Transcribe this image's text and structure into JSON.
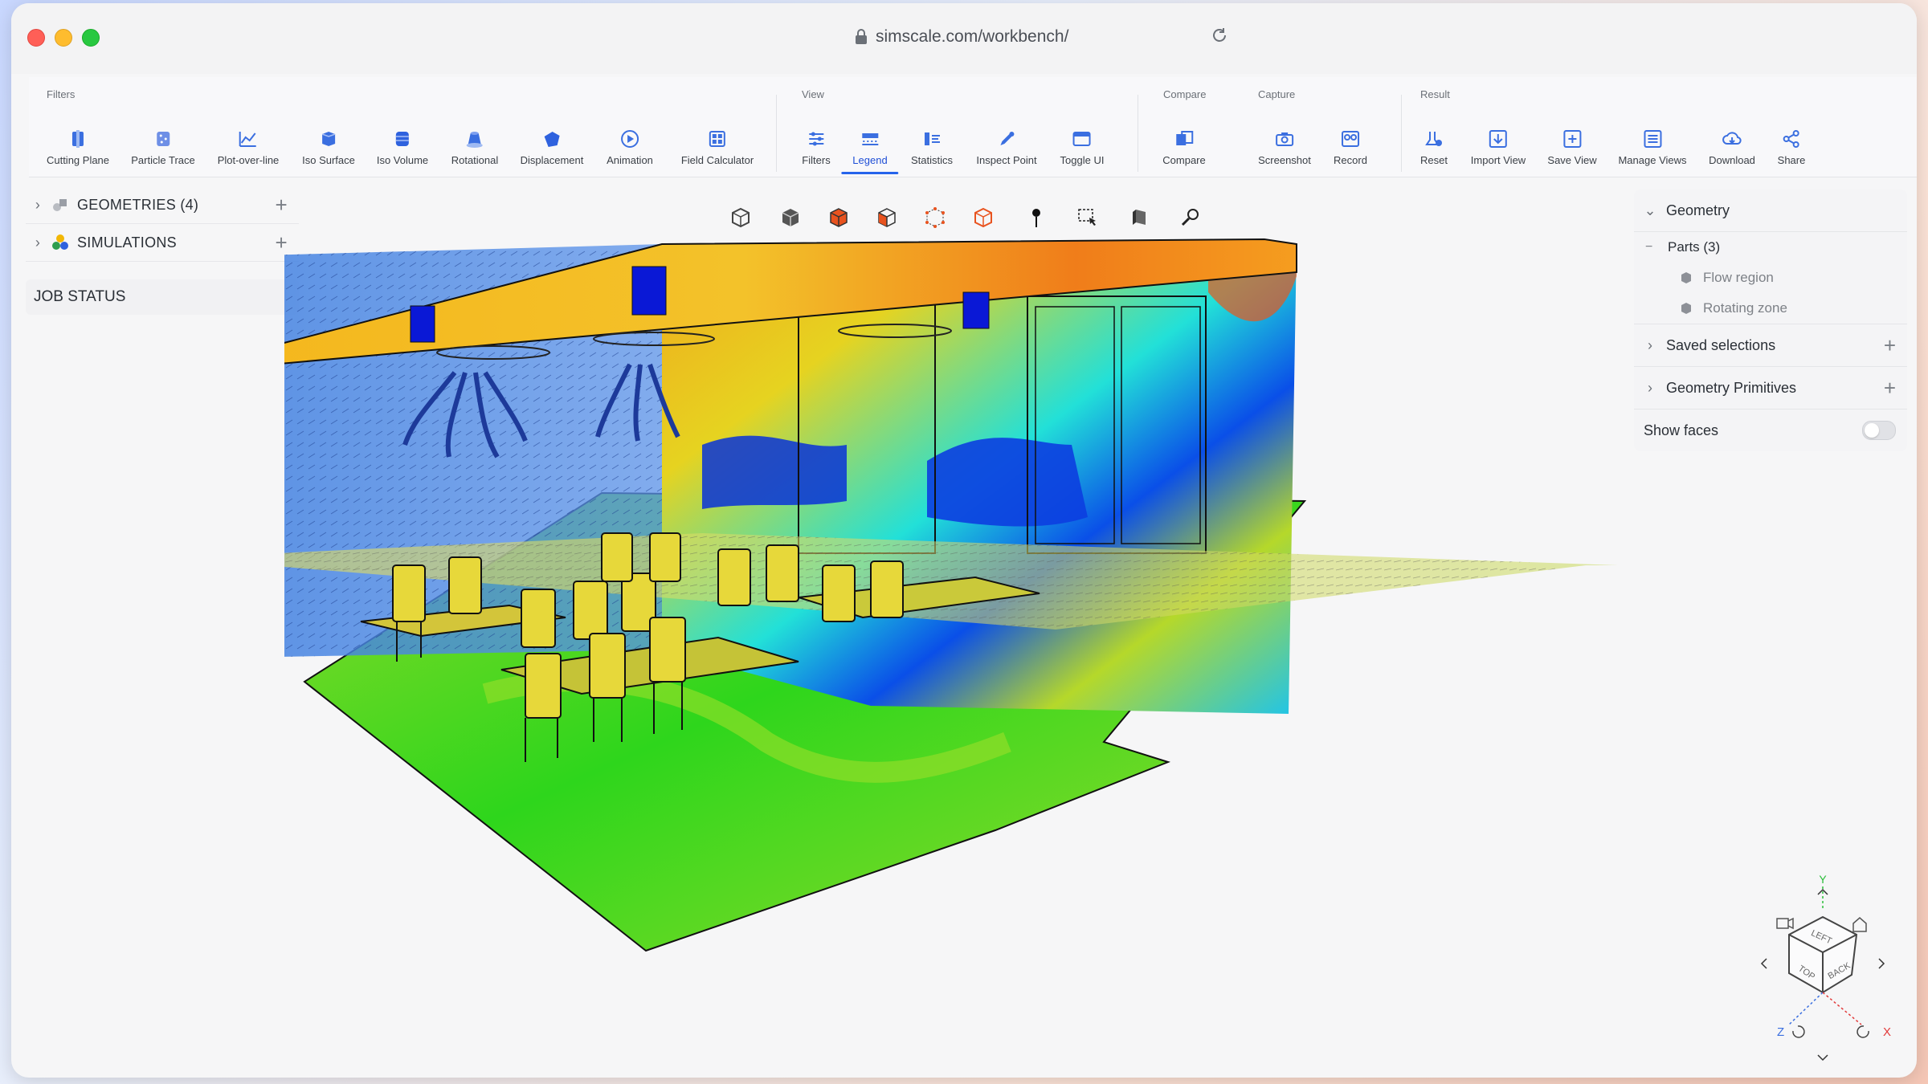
{
  "browser": {
    "url": "simscale.com/workbench/"
  },
  "ribbon": {
    "groups": [
      {
        "label": "Filters",
        "tools": [
          "Cutting Plane",
          "Particle Trace",
          "Plot-over-line",
          "Iso Surface",
          "Iso Volume",
          "Rotational",
          "Displacement",
          "Animation",
          "Field Calculator"
        ]
      },
      {
        "label": "View",
        "tools": [
          "Filters",
          "Legend",
          "Statistics",
          "Inspect Point",
          "Toggle UI"
        ]
      },
      {
        "label": "Compare",
        "tools": [
          "Compare"
        ]
      },
      {
        "label": "Capture",
        "tools": [
          "Screenshot",
          "Record"
        ]
      },
      {
        "label": "Result",
        "tools": [
          "Reset",
          "Import View",
          "Save View",
          "Manage Views",
          "Download",
          "Share"
        ]
      }
    ],
    "active_tool": "Legend"
  },
  "left_panel": {
    "geometries": "GEOMETRIES (4)",
    "simulations": "SIMULATIONS",
    "job_status": "JOB STATUS"
  },
  "right_panel": {
    "geometry": "Geometry",
    "parts": "Parts (3)",
    "part_items": [
      "Flow region",
      "Rotating zone"
    ],
    "saved_selections": "Saved selections",
    "geometry_primitives": "Geometry Primitives",
    "show_faces": "Show faces",
    "show_faces_on": false
  },
  "nav_cube": {
    "faces": [
      "LEFT",
      "TOP",
      "BACK"
    ],
    "axes": [
      "Y",
      "Z",
      "X"
    ]
  },
  "colors": {
    "accent": "#2563eb",
    "legend_blue": "#0019d8",
    "legend_red": "#e2250a"
  }
}
